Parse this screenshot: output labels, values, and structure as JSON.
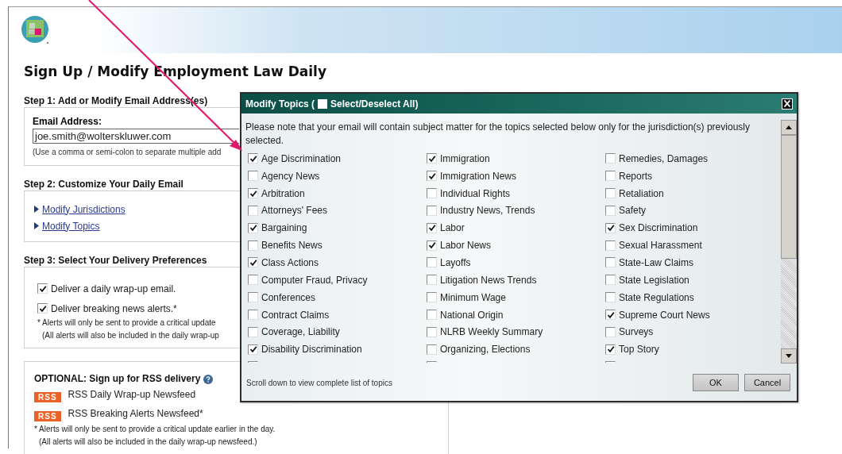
{
  "header": {
    "title": "Sign Up / Modify Employment Law Daily"
  },
  "step1": {
    "heading": "Step 1: Add or Modify Email Address(es)",
    "email_label": "Email Address:",
    "email_value": "joe.smith@wolterskluwer.com",
    "hint": "(Use a comma or semi-colon to separate multiple add"
  },
  "step2": {
    "heading": "Step 2: Customize Your Daily Email",
    "links": [
      "Modify Jurisdictions",
      "Modify Topics"
    ]
  },
  "step3": {
    "heading": "Step 3: Select Your Delivery Preferences",
    "options": [
      {
        "label": "Deliver a daily wrap-up email.",
        "checked": true
      },
      {
        "label": "Deliver breaking news alerts.*",
        "checked": true
      }
    ],
    "notes": [
      "* Alerts will only be sent to provide a critical update",
      "(All alerts will also be included in the daily wrap-up"
    ]
  },
  "rss": {
    "heading": "OPTIONAL: Sign up for RSS delivery",
    "feeds": [
      {
        "badge": "RSS",
        "label": "RSS Daily Wrap-up Newsfeed"
      },
      {
        "badge": "RSS",
        "label": "RSS Breaking Alerts Newsfeed*"
      }
    ],
    "notes": [
      "* Alerts will only be sent to provide a critical update earlier in the day.",
      "(All alerts will also be included in the daily wrap-up newsfeed.)"
    ]
  },
  "dialog": {
    "title": "Modify Topics (",
    "select_all": {
      "label": "Select/Deselect All)",
      "checked": false
    },
    "note": "Please note that your email will contain subject matter for the topics selected below only for the jurisdiction(s) previously selected.",
    "columns": [
      [
        {
          "label": "Age Discrimination",
          "checked": true
        },
        {
          "label": "Agency News",
          "checked": false
        },
        {
          "label": "Arbitration",
          "checked": true
        },
        {
          "label": "Attorneys' Fees",
          "checked": false
        },
        {
          "label": "Bargaining",
          "checked": true
        },
        {
          "label": "Benefits News",
          "checked": false
        },
        {
          "label": "Class Actions",
          "checked": true
        },
        {
          "label": "Computer Fraud, Privacy",
          "checked": false
        },
        {
          "label": "Conferences",
          "checked": false
        },
        {
          "label": "Contract Claims",
          "checked": false
        },
        {
          "label": "Coverage, Liability",
          "checked": false
        },
        {
          "label": "Disability Discrimination",
          "checked": true
        }
      ],
      [
        {
          "label": "Immigration",
          "checked": true
        },
        {
          "label": "Immigration News",
          "checked": true
        },
        {
          "label": "Individual Rights",
          "checked": false
        },
        {
          "label": "Industry News, Trends",
          "checked": false
        },
        {
          "label": "Labor",
          "checked": true
        },
        {
          "label": "Labor News",
          "checked": true
        },
        {
          "label": "Layoffs",
          "checked": false
        },
        {
          "label": "Litigation News Trends",
          "checked": false
        },
        {
          "label": "Minimum Wage",
          "checked": false
        },
        {
          "label": "National Origin",
          "checked": false
        },
        {
          "label": "NLRB Weekly Summary",
          "checked": false
        },
        {
          "label": "Organizing, Elections",
          "checked": false
        }
      ],
      [
        {
          "label": "Remedies, Damages",
          "checked": false
        },
        {
          "label": "Reports",
          "checked": false
        },
        {
          "label": "Retaliation",
          "checked": false
        },
        {
          "label": "Safety",
          "checked": false
        },
        {
          "label": "Sex Discrimination",
          "checked": true
        },
        {
          "label": "Sexual Harassment",
          "checked": false
        },
        {
          "label": "State-Law Claims",
          "checked": false
        },
        {
          "label": "State Legislation",
          "checked": false
        },
        {
          "label": "State Regulations",
          "checked": false
        },
        {
          "label": "Supreme Court News",
          "checked": true
        },
        {
          "label": "Surveys",
          "checked": false
        },
        {
          "label": "Top Story",
          "checked": true
        }
      ]
    ],
    "list_continues": true,
    "footer": "Scroll down to view complete list of topics",
    "buttons": [
      "OK",
      "Cancel"
    ]
  }
}
